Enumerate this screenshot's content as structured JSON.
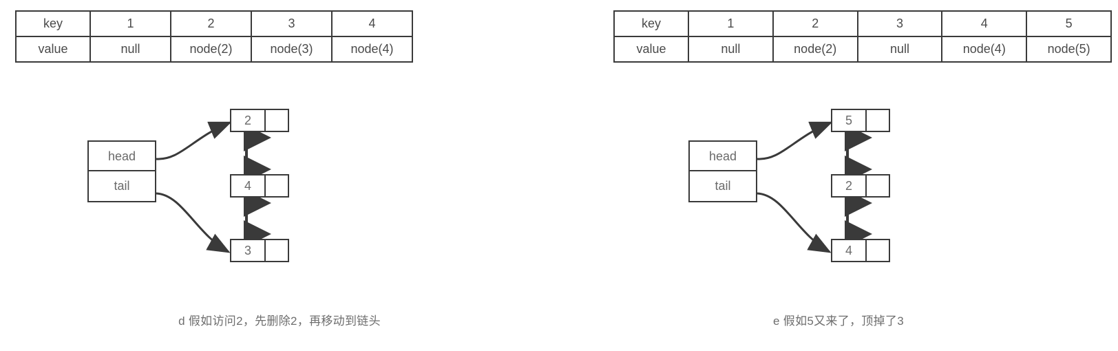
{
  "page": {
    "background": "#ffffff",
    "stroke_color": "#3a3a3a",
    "text_color": "#6a6a6a"
  },
  "panels": [
    {
      "id": "d",
      "caption": "d 假如访问2，先删除2，再移动到链头",
      "hash_table": {
        "row_labels": {
          "key": "key",
          "value": "value"
        },
        "keys": [
          "1",
          "2",
          "3",
          "4"
        ],
        "values": [
          "null",
          "node(2)",
          "node(3)",
          "node(4)"
        ]
      },
      "pointer_box": {
        "head": "head",
        "tail": "tail"
      },
      "nodes": [
        {
          "value": "2"
        },
        {
          "value": "4"
        },
        {
          "value": "3"
        }
      ]
    },
    {
      "id": "e",
      "caption": "e 假如5又来了，顶掉了3",
      "hash_table": {
        "row_labels": {
          "key": "key",
          "value": "value"
        },
        "keys": [
          "1",
          "2",
          "3",
          "4",
          "5"
        ],
        "values": [
          "null",
          "node(2)",
          "null",
          "node(4)",
          "node(5)"
        ]
      },
      "pointer_box": {
        "head": "head",
        "tail": "tail"
      },
      "nodes": [
        {
          "value": "5"
        },
        {
          "value": "2"
        },
        {
          "value": "4"
        }
      ]
    }
  ]
}
